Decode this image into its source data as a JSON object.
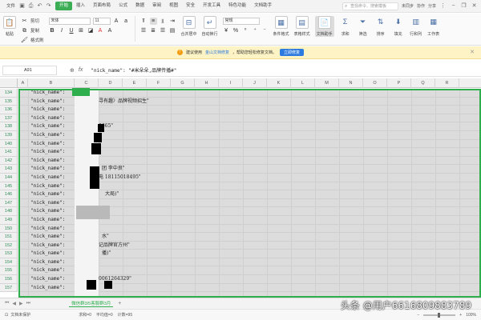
{
  "menubar": {
    "file_label": "文件",
    "quick_icons": [
      "save-icon",
      "print-icon",
      "undo-icon",
      "redo-icon"
    ],
    "tabs": [
      "开始",
      "插入",
      "页面布局",
      "公式",
      "数据",
      "审阅",
      "视图",
      "安全",
      "开发工具",
      "特色功能",
      "文档助手"
    ],
    "active_tab": "开始",
    "search_placeholder": "查找命令、搜索模板",
    "right_links": [
      "未同步",
      "协作",
      "分享"
    ]
  },
  "ribbon": {
    "paste_label": "粘贴",
    "cut_label": "剪切",
    "copy_label": "复制",
    "format_painter_label": "格式刷",
    "font_name": "宋体",
    "font_size": "11",
    "format_buttons": [
      "B",
      "I",
      "U",
      "A",
      "A"
    ],
    "merge_label": "合并居中",
    "wrap_label": "自动换行",
    "number_format": "常规",
    "conditional_format_label": "条件格式",
    "table_style_label": "表格样式",
    "doc_helper_label": "文档助手",
    "sum_label": "求和",
    "filter_label": "筛选",
    "sort_label": "排序",
    "fill_label": "填充",
    "rowcol_label": "行和列",
    "sheet_label": "工作表"
  },
  "notice": {
    "text_before": "建议使用",
    "link_text": "金山文档修复",
    "text_after": "，帮助您轻松修复文档。",
    "button_label": "立即修复"
  },
  "formula_bar": {
    "cell_ref": "A91",
    "content": "\"nick_name\": \"#米朵朵,品牌传播#\""
  },
  "grid": {
    "columns": [
      "A",
      "B",
      "C",
      "D",
      "E",
      "F",
      "G",
      "H",
      "I",
      "J",
      "K",
      "L",
      "M",
      "N",
      "O",
      "P",
      "Q",
      "R"
    ],
    "rows": [
      {
        "num": "134",
        "text": "\"nick_name\": ",
        "extra": ""
      },
      {
        "num": "135",
        "text": "\"nick_name\": ",
        "extra": "寻有趣〉品牌视频招生\""
      },
      {
        "num": "136",
        "text": "\"nick_name\": ",
        "extra": ""
      },
      {
        "num": "137",
        "text": "\"nick_name\": ",
        "extra": ""
      },
      {
        "num": "138",
        "text": "\"nick_name\": ",
        "extra": "0665\""
      },
      {
        "num": "139",
        "text": "\"nick_name\": ",
        "extra": ""
      },
      {
        "num": "140",
        "text": "\"nick_name\": ",
        "extra": ""
      },
      {
        "num": "141",
        "text": "\"nick_name\": ",
        "extra": ""
      },
      {
        "num": "142",
        "text": "\"nick_name\": ",
        "extra": ""
      },
      {
        "num": "143",
        "text": "\"nick_name\": ",
        "extra": "团  李中良\""
      },
      {
        "num": "144",
        "text": "\"nick_name\": ",
        "extra": "电 18115018495\""
      },
      {
        "num": "145",
        "text": "\"nick_name\": ",
        "extra": ""
      },
      {
        "num": "146",
        "text": "\"nick_name\": ",
        "extra": "大局)\""
      },
      {
        "num": "147",
        "text": "\"nick_name\": ",
        "extra": ""
      },
      {
        "num": "148",
        "text": "\"nick_name\": ",
        "extra": ""
      },
      {
        "num": "149",
        "text": "\"nick_name\": ",
        "extra": ""
      },
      {
        "num": "150",
        "text": "\"nick_name\": ",
        "extra": ""
      },
      {
        "num": "151",
        "text": "\"nick_name\": ",
        "extra": "水\""
      },
      {
        "num": "152",
        "text": "\"nick_name\": ",
        "extra": "记品牌官方州\""
      },
      {
        "num": "153",
        "text": "\"nick_name\": ",
        "extra": "播)\""
      },
      {
        "num": "154",
        "text": "\"nick_name\": ",
        "extra": ""
      },
      {
        "num": "155",
        "text": "\"nick_name\": ",
        "extra": ""
      },
      {
        "num": "156",
        "text": "\"nick_name\": ",
        "extra": "0061264329\""
      },
      {
        "num": "157",
        "text": "\"nick_name\": ",
        "extra": ""
      }
    ]
  },
  "sheetbar": {
    "sheet_name": "微信群3/5客服群3月"
  },
  "statusbar": {
    "left_text": "文档未保护",
    "count_text": "求和=0",
    "avg_text": "平均值=0",
    "items_text": "计数=95",
    "zoom": "100%"
  },
  "watermark": "头条 @用户6616809883789"
}
